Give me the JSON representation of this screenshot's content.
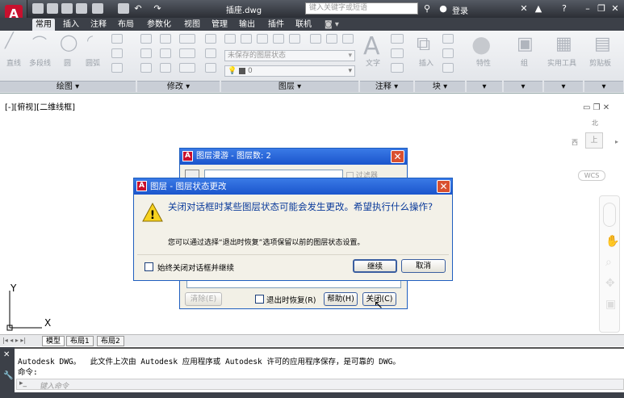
{
  "title": {
    "file": "插座.dwg",
    "search_placeholder": "键入关键字或短语",
    "login": "登录"
  },
  "tabs": [
    "常用",
    "插入",
    "注释",
    "布局",
    "参数化",
    "视图",
    "管理",
    "输出",
    "插件",
    "联机"
  ],
  "ribbon": {
    "draw_tools": [
      "直线",
      "多段线",
      "圆",
      "圆弧"
    ],
    "layer_state": "未保存的图层状态",
    "layer_value": "0",
    "text_label": "文字",
    "insert_label": "插入",
    "feature_label": "特性",
    "group_label": "组",
    "utility_label": "实用工具",
    "clipboard_label": "剪贴板",
    "panels": [
      "绘图",
      "修改",
      "图层",
      "注释",
      "块"
    ]
  },
  "viewport": {
    "label": "[-][俯视][二维线框]",
    "north": "北",
    "west": "西",
    "top": "上",
    "wcs": "WCS",
    "axis_y": "Y",
    "axis_x": "X"
  },
  "layer_filter_dialog": {
    "title": "图层漫游 - 图层数: 2",
    "filter_label": "过滤器",
    "clear_button": "清除(E)",
    "restore_checkbox": "退出时恢复(R)",
    "help_button": "帮助(H)",
    "close_button": "关闭(C)"
  },
  "alert_dialog": {
    "title": "图层 - 图层状态更改",
    "heading": "关闭对话框时某些图层状态可能会发生更改。希望执行什么操作?",
    "body": "您可以通过选择“退出时恢复”选项保留以前的图层状态设置。",
    "always_checkbox": "始终关闭对话框并继续",
    "continue_button": "继续",
    "cancel_button": "取消"
  },
  "layout_tabs": [
    "模型",
    "布局1",
    "布局2"
  ],
  "command": {
    "line1": "Autodesk DWG。  此文件上次由 Autodesk 应用程序或 Autodesk 许可的应用程序保存，是可靠的 DWG。",
    "line2": "命令:",
    "placeholder": "键入命令"
  }
}
